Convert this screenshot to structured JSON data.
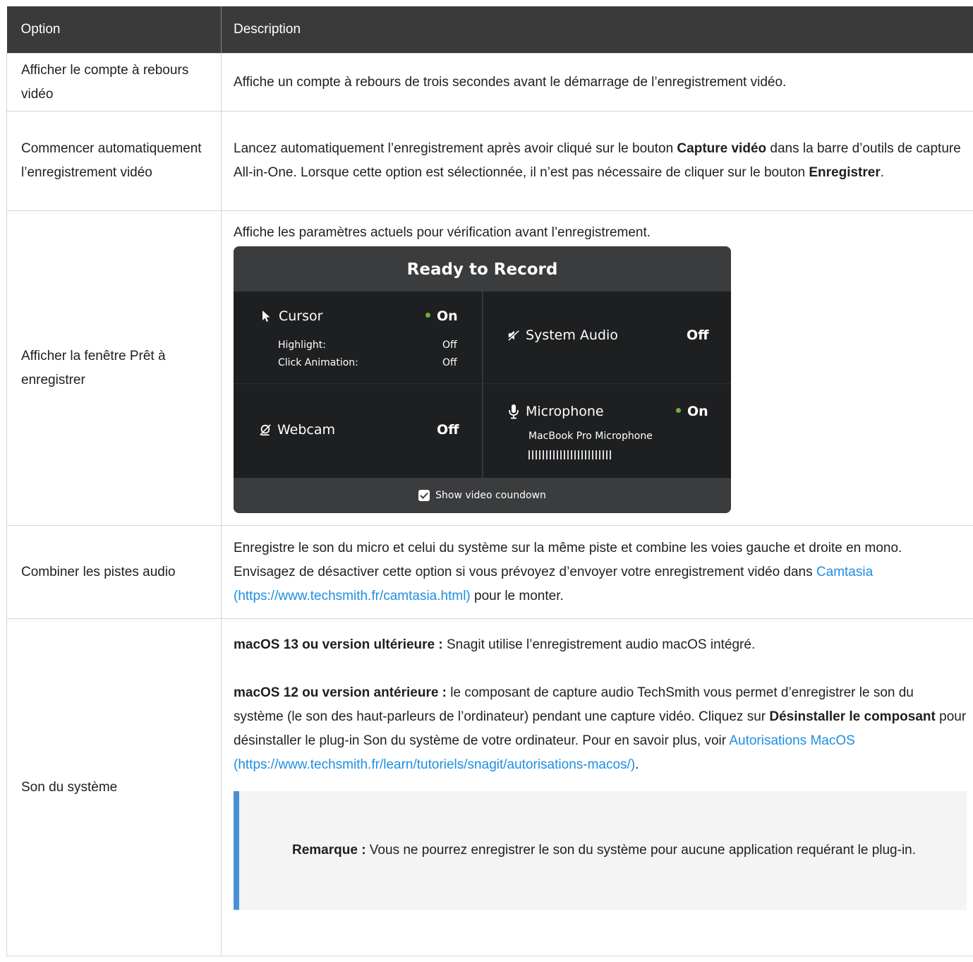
{
  "table": {
    "headers": {
      "option": "Option",
      "description": "Description"
    },
    "rows": [
      {
        "option": "Afficher le compte à rebours vidéo",
        "description": "Affiche un compte à rebours de trois secondes avant le démarrage de l’enregistrement vidéo."
      },
      {
        "option": "Commencer automatiquement l’enregistrement vidéo",
        "desc_part1": "Lancez automatiquement l’enregistrement après avoir cliqué sur le bouton ",
        "desc_bold1": "Capture vidéo",
        "desc_part2": " dans la barre d’outils de capture All-in-One. Lorsque cette option est sélectionnée, il n’est pas nécessaire de cliquer sur le bouton ",
        "desc_bold2": "Enregistrer",
        "desc_part3": "."
      },
      {
        "option": "Afficher la fenêtre Prêt à enregistrer",
        "description": "Affiche les paramètres actuels pour vérification avant l’enregistrement."
      },
      {
        "option": "Combiner les pistes audio",
        "desc_part1": "Enregistre le son du micro et celui du système sur la même piste et combine les voies gauche et droite en mono. Envisagez de désactiver cette option si vous prévoyez d’envoyer votre enregistrement vidéo dans ",
        "link": "Camtasia (https://www.techsmith.fr/camtasia.html)",
        "desc_part2": " pour le monter."
      },
      {
        "option": "Son du système",
        "p1_bold": "macOS 13 ou version ultérieure :",
        "p1_text": " Snagit utilise l’enregistrement audio macOS intégré.",
        "p2_bold": "macOS 12 ou version antérieure :",
        "p2_text1": " le composant de capture audio TechSmith vous permet d’enregistrer le son du système (le son des haut-parleurs de l’ordinateur) pendant une capture vidéo. Cliquez sur ",
        "p2_bold2": "Désinstaller le composant",
        "p2_text2": " pour désinstaller le plug-in Son du système de votre ordinateur. Pour en savoir plus, voir ",
        "p2_link": "Autorisations MacOS (https://www.techsmith.fr/learn/tutoriels/snagit/autorisations-macos/)",
        "p2_text3": ".",
        "note_bold": "Remarque :",
        "note_text": " Vous ne pourrez enregistrer le son du système pour aucune application requérant le plug-in."
      }
    ]
  },
  "ready_to_record": {
    "title": "Ready to Record",
    "cursor": {
      "label": "Cursor",
      "state": "On",
      "highlight_label": "Highlight:",
      "highlight_value": "Off",
      "click_label": "Click Animation:",
      "click_value": "Off",
      "icon": "cursor-arrow-icon"
    },
    "system_audio": {
      "label": "System Audio",
      "state": "Off",
      "icon": "speaker-muted-icon"
    },
    "webcam": {
      "label": "Webcam",
      "state": "Off",
      "icon": "webcam-off-icon"
    },
    "microphone": {
      "label": "Microphone",
      "state": "On",
      "device": "MacBook Pro Microphone",
      "icon": "microphone-icon",
      "level_bars": 24
    },
    "footer": {
      "label": "Show video coundown",
      "checked": true
    },
    "colors": {
      "on_dot": "#71b03b",
      "panel_bg": "#1e1f21",
      "header_bg": "#3b3c3e"
    }
  },
  "colors": {
    "link": "#1f8ee0",
    "header_bg": "#3a3a3a",
    "note_accent": "#4a90d9",
    "note_bg": "#f4f4f4"
  }
}
